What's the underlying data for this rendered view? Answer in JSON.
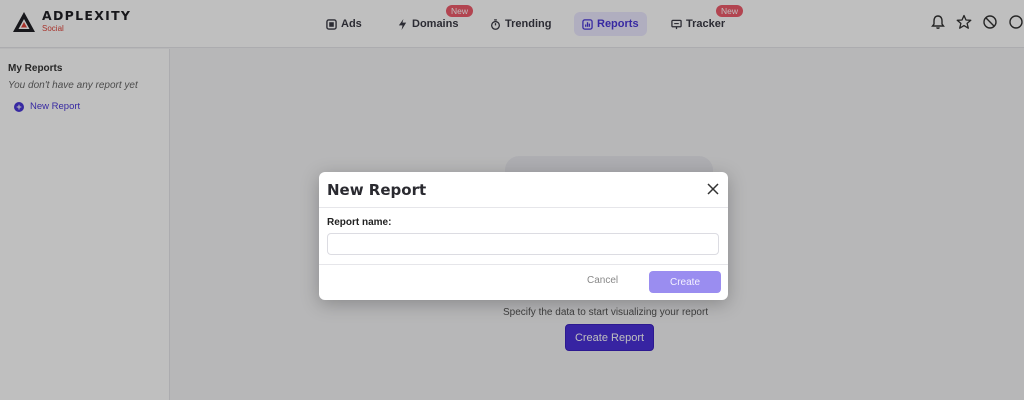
{
  "brand": {
    "name": "ADPLEXITY",
    "subtitle": "Social"
  },
  "nav": {
    "items": [
      {
        "label": "Ads",
        "icon": "ads-icon"
      },
      {
        "label": "Domains",
        "icon": "lightning-icon",
        "badge": "New"
      },
      {
        "label": "Trending",
        "icon": "timer-icon"
      },
      {
        "label": "Reports",
        "icon": "chart-icon",
        "active": true
      },
      {
        "label": "Tracker",
        "icon": "tracker-icon",
        "badge": "New"
      }
    ]
  },
  "header_icons": [
    "bell-icon",
    "star-icon",
    "block-icon"
  ],
  "sidebar": {
    "title": "My Reports",
    "empty_text": "You don't have any report yet",
    "new_report_label": "New Report"
  },
  "main": {
    "empty_message": "Specify the data to start visualizing your report",
    "create_button_label": "Create Report"
  },
  "modal": {
    "title": "New Report",
    "field_label": "Report name:",
    "field_value": "",
    "cancel_label": "Cancel",
    "create_label": "Create"
  },
  "colors": {
    "accent": "#4a30d8",
    "accent_disabled": "#9a8df0",
    "badge": "#ee5b6b",
    "brand_sub": "#e0443a"
  }
}
